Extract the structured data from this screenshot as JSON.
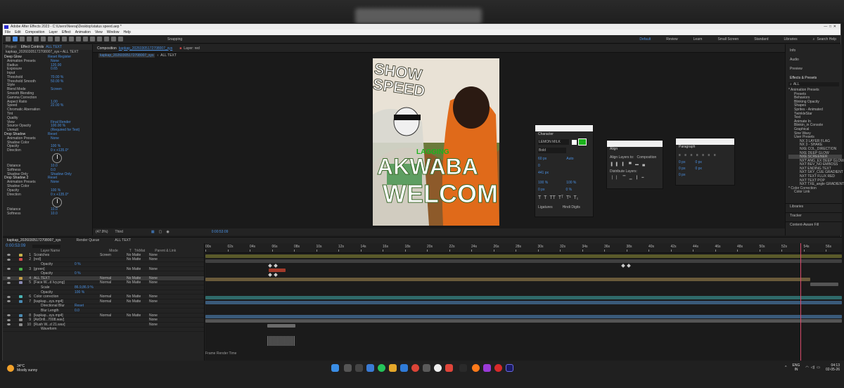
{
  "app": {
    "title": "Adobe After Effects 2023 - C:\\Users\\Neeraj\\Desktop\\status speed.aep *",
    "menu": [
      "File",
      "Edit",
      "Composition",
      "Layer",
      "Effect",
      "Animation",
      "View",
      "Window",
      "Help"
    ],
    "snapping": "Snapping",
    "workspaces": [
      "Default",
      "Review",
      "Learn",
      "Small Screen",
      "Standard",
      "Libraries"
    ],
    "search_help": "Search Help"
  },
  "effect_controls": {
    "tab": "Effect Controls",
    "layer": "ALL TEXT",
    "source": "kapkap_20260305172708007_sys • ALL TEXT",
    "rows": [
      {
        "label": "Deep Glow",
        "value": "Reset  Register",
        "head": true
      },
      {
        "label": "Animation Presets",
        "value": "None"
      },
      {
        "label": "Radius",
        "value": "120.00"
      },
      {
        "label": "Exposure",
        "value": "0.65"
      },
      {
        "label": "Input",
        "value": ""
      },
      {
        "label": "Threshold",
        "value": "70.00 %"
      },
      {
        "label": "Threshold Smooth",
        "value": "50.00 %"
      },
      {
        "label": "Style",
        "value": ""
      },
      {
        "label": "Blend Mode",
        "value": "Screen"
      },
      {
        "label": "Smooth Blending",
        "value": ""
      },
      {
        "label": "Gamma Correction",
        "value": ""
      },
      {
        "label": "Aspect Ratio",
        "value": "1.00"
      },
      {
        "label": "Speed",
        "value": "22.00 %"
      },
      {
        "label": "Chromatic Aberration",
        "value": ""
      },
      {
        "label": "Tint",
        "value": ""
      },
      {
        "label": "Quality",
        "value": ""
      },
      {
        "label": "View",
        "value": "Final Render"
      },
      {
        "label": "Source Opacity",
        "value": "100.00 %"
      },
      {
        "label": "Unmult",
        "value": "(Required for Text)"
      },
      {
        "label": "Drop Shadow",
        "value": "Reset",
        "head": true
      },
      {
        "label": "Animation Presets",
        "value": "None"
      },
      {
        "label": "Shadow Color",
        "value": ""
      },
      {
        "label": "Opacity",
        "value": "100 %"
      },
      {
        "label": "Direction",
        "value": "0 x +135.0°"
      }
    ],
    "rows2": [
      {
        "label": "Distance",
        "value": "10.0"
      },
      {
        "label": "Softness",
        "value": "0.0"
      },
      {
        "label": "Shadow Only",
        "value": "Shadow Only"
      },
      {
        "label": "Drop Shadow 2",
        "value": "Reset",
        "head": true
      },
      {
        "label": "Animation Presets",
        "value": "None"
      },
      {
        "label": "Shadow Color",
        "value": ""
      },
      {
        "label": "Opacity",
        "value": "100 %"
      },
      {
        "label": "Direction",
        "value": "0 x +135.0°"
      }
    ],
    "rows3": [
      {
        "label": "Distance",
        "value": "10.0"
      },
      {
        "label": "Softness",
        "value": "10.0"
      }
    ]
  },
  "composition": {
    "tab": "Composition",
    "comp_name": "kapkap_20260305172708007_sys",
    "breadcrumbs": [
      "kapkap_20260305172708007_sys",
      "ALL TEXT"
    ],
    "layer_tab": "Layer: red",
    "canvas_text": {
      "show": "SHOW",
      "speed": "SPEED",
      "lagging": "LAGGING",
      "akwaba": "AKWABA",
      "welcome": "WELCOME"
    },
    "zoom": "(47.9%)",
    "resolution": "Third",
    "timecode": "0:00:53:09"
  },
  "character_panel": {
    "title": "Character",
    "font": "LEMON MILK",
    "style": "Bold",
    "size": "60 px",
    "leading": "Auto",
    "tracking": "0",
    "vscale": "100 %",
    "hscale": "100 %",
    "baseline": "0 px",
    "tsume": "0 %",
    "stroke": "441 px",
    "ligatures": "Ligatures",
    "hindi": "Hindi Digits",
    "fill_color": "#1db31d"
  },
  "align_panel": {
    "title": "Align",
    "align_to": "Align Layers to:",
    "align_to_value": "Composition",
    "distribute": "Distribute Layers:"
  },
  "paragraph_panel": {
    "title": "Paragraph",
    "values": [
      "0 px",
      "0 px",
      "0 px",
      "0 px",
      "0 px"
    ]
  },
  "right_panel": {
    "items": [
      "Info",
      "Audio",
      "Preview",
      "Effects & Presets"
    ],
    "search": "ALL",
    "tree": [
      "* Animation Presets",
      "Presets",
      "Behaviors",
      "Blinking Opacity",
      "Shapes",
      "Sprites - Animated",
      "TwinkleStar",
      "Text",
      "Animate In",
      "Blinkin_in Console",
      "Graphical",
      "Sine Wavy",
      "User Presets",
      "NX 3 LAYER FLAG",
      "NX 3 - SHAKE",
      "NXE COL_DIRECTION",
      "NXE DEEP GLOW",
      "NXE SCREENER",
      "NXT ANG_EX DEEP GLOW",
      "NXT BEV_NO EMBOSS",
      "NXT ENDING TEXT",
      "NXT SKY_CUE GRADIENT",
      "NXT TEXT FLUX RED",
      "NXT TEXT POP",
      "NXT TXE_angle GRADIENT",
      "* Color Correction",
      "Color Link"
    ],
    "bottom": [
      "Libraries",
      "Tracker",
      "Content-Aware Fill"
    ]
  },
  "timeline": {
    "comp_tab": "kapkap_20260305172708007_sys",
    "render_queue": "Render Queue",
    "all_text_tab": "ALL TEXT",
    "timecode": "0:00:53:09",
    "columns": [
      "Layer Name",
      "Mode",
      "T",
      "TrkMat",
      "Parent & Link"
    ],
    "ruler": [
      "00s",
      "02s",
      "04s",
      "06s",
      "08s",
      "10s",
      "12s",
      "14s",
      "16s",
      "18s",
      "20s",
      "22s",
      "24s",
      "26s",
      "28s",
      "30s",
      "32s",
      "34s",
      "36s",
      "38s",
      "40s",
      "42s",
      "44s",
      "46s",
      "48s",
      "50s",
      "52s",
      "54s",
      "56s"
    ],
    "layers": [
      {
        "num": "1",
        "name": "Scratches",
        "mode": "Screen",
        "trk": "No Matte",
        "parent": "None",
        "color": "#c6b34a"
      },
      {
        "num": "2",
        "name": "[red]",
        "mode": "",
        "trk": "No Matte",
        "parent": "None",
        "color": "#d14a4a"
      },
      {
        "num": "",
        "name": "Opacity",
        "mode": "",
        "trk": "",
        "parent": "",
        "color": "",
        "prop": true,
        "value": "0 %"
      },
      {
        "num": "3",
        "name": "[green]",
        "mode": "",
        "trk": "No Matte",
        "parent": "None",
        "color": "#4ab34a"
      },
      {
        "num": "",
        "name": "Opacity",
        "mode": "",
        "trk": "",
        "parent": "",
        "color": "",
        "prop": true,
        "value": "0 %"
      },
      {
        "num": "4",
        "name": "ALL TEXT",
        "mode": "Normal",
        "trk": "No Matte",
        "parent": "None",
        "color": "#c6a04a"
      },
      {
        "num": "5",
        "name": "[Face W...d Ivy.png]",
        "mode": "Normal",
        "trk": "No Matte",
        "parent": "None",
        "color": "#8a8ab3"
      },
      {
        "num": "",
        "name": "Scale",
        "mode": "",
        "trk": "",
        "parent": "",
        "color": "",
        "prop": true,
        "value": "86.9,86.9 %"
      },
      {
        "num": "",
        "name": "Opacity",
        "mode": "",
        "trk": "",
        "parent": "",
        "color": "",
        "prop": true,
        "value": "100 %"
      },
      {
        "num": "6",
        "name": "Color correction",
        "mode": "Normal",
        "trk": "No Matte",
        "parent": "None",
        "color": "#4ab3b3"
      },
      {
        "num": "7",
        "name": "[kapkap...sys.mp4]",
        "mode": "Normal",
        "trk": "No Matte",
        "parent": "None",
        "color": "#4a8ab3"
      },
      {
        "num": "",
        "name": "Directional Blur",
        "mode": "",
        "trk": "",
        "parent": "",
        "color": "",
        "prop": true,
        "value": "Reset"
      },
      {
        "num": "",
        "name": "Blur Length",
        "mode": "",
        "trk": "",
        "parent": "",
        "color": "",
        "prop": true,
        "value": "0.0"
      },
      {
        "num": "8",
        "name": "[kapkap...sys.mp4]",
        "mode": "Normal",
        "trk": "No Matte",
        "parent": "None",
        "color": "#4a8ab3"
      },
      {
        "num": "9",
        "name": "[AirDrill...7008.wav]",
        "mode": "",
        "trk": "",
        "parent": "None",
        "color": "#8a8a8a"
      },
      {
        "num": "10",
        "name": "[Rush W...d 21.wav]",
        "mode": "",
        "trk": "",
        "parent": "None",
        "color": "#8a8a8a"
      },
      {
        "num": "",
        "name": "Waveform",
        "mode": "",
        "trk": "",
        "parent": "",
        "color": "",
        "prop": true,
        "value": ""
      }
    ],
    "waveform_label": "Waveform",
    "footer": "Frame Render Time"
  },
  "taskbar": {
    "weather_temp": "34°C",
    "weather_text": "Mostly sunny",
    "lang": "ENG",
    "region": "IN",
    "time": "04:13",
    "date": "02-05-26"
  }
}
